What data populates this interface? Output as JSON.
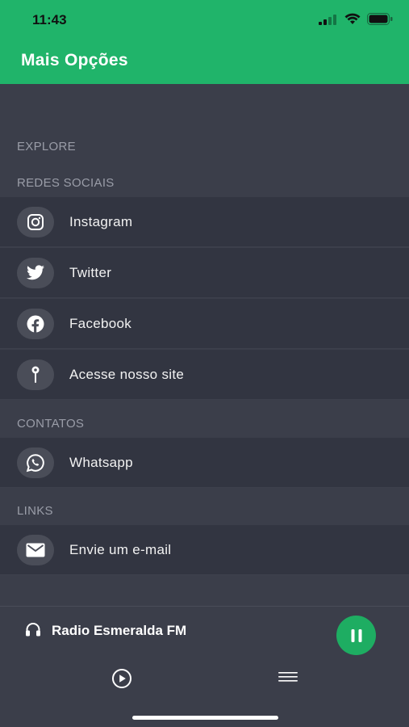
{
  "status_bar": {
    "time": "11:43"
  },
  "header": {
    "title": "Mais Opções"
  },
  "sections": {
    "explore": "EXPLORE",
    "social": "REDES SOCIAIS",
    "contacts": "CONTATOS",
    "links": "LINKS"
  },
  "items": {
    "instagram": {
      "label": "Instagram",
      "icon": "instagram-icon"
    },
    "twitter": {
      "label": "Twitter",
      "icon": "twitter-icon"
    },
    "facebook": {
      "label": "Facebook",
      "icon": "facebook-icon"
    },
    "site": {
      "label": "Acesse nosso site",
      "icon": "pin-icon"
    },
    "whatsapp": {
      "label": "Whatsapp",
      "icon": "whatsapp-icon"
    },
    "email": {
      "label": "Envie um e-mail",
      "icon": "mail-icon"
    }
  },
  "player": {
    "station": "Radio Esmeralda FM",
    "state": "playing"
  },
  "colors": {
    "header": "#20b46a",
    "background": "#3b3e4a",
    "row": "#323541",
    "accent": "#1ead62"
  }
}
